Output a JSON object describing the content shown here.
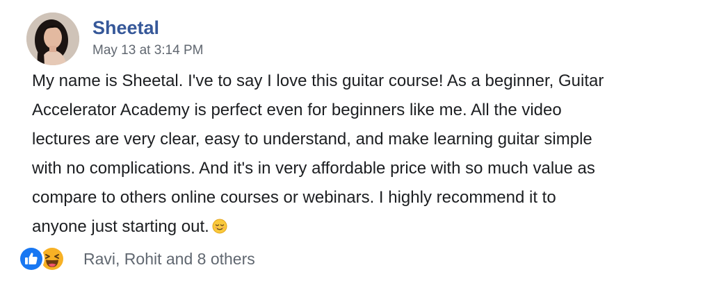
{
  "post": {
    "author": "Sheetal",
    "timestamp": "May 13 at 3:14 PM",
    "body_lines": [
      "My name is Sheetal. I've to say I love this guitar course! As a beginner, Guitar",
      "Accelerator Academy is perfect even for beginners like me. All the video",
      "lectures are very clear, easy to understand, and make learning guitar simple",
      "with no complications. And it's in very affordable price with so much value as",
      "compare to others online courses or webinars. I highly recommend it to",
      "anyone just starting out."
    ],
    "trailing_emoji": "relieved-face-emoji"
  },
  "reactions": {
    "icons": [
      "like-icon",
      "haha-icon"
    ],
    "summary": "Ravi, Rohit and 8 others"
  },
  "colors": {
    "author": "#365899",
    "meta": "#606770",
    "text": "#1c1e21",
    "like": "#1877f2",
    "haha": "#f7b125"
  }
}
